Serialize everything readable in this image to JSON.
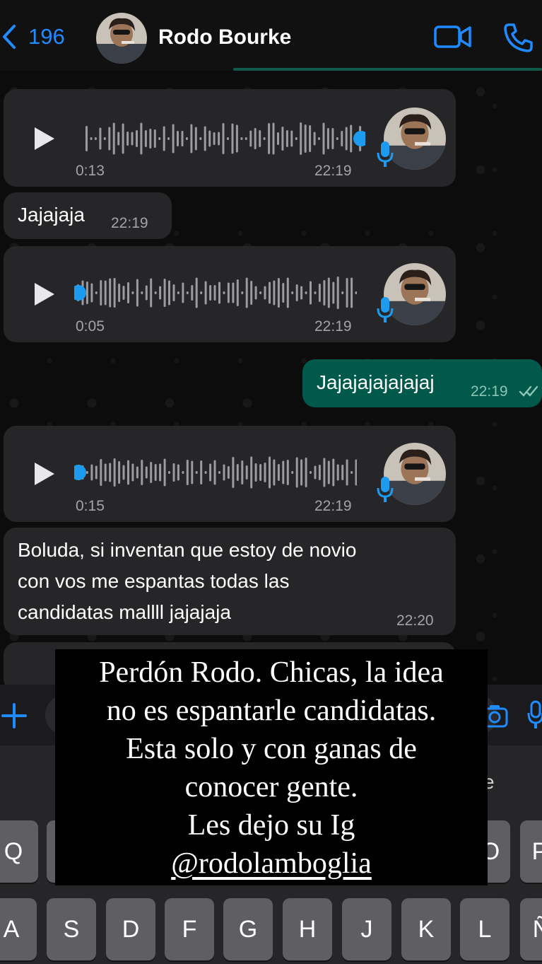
{
  "header": {
    "back_count": "196",
    "contact_name": "Rodo Bourke"
  },
  "messages": [
    {
      "type": "voice",
      "duration": "0:13",
      "time": "22:19",
      "played_fraction": 1.0
    },
    {
      "type": "text",
      "text": "Jajajaja",
      "time": "22:19"
    },
    {
      "type": "voice",
      "duration": "0:05",
      "time": "22:19",
      "played_fraction": 0.0
    },
    {
      "type": "text_out",
      "text": "Jajajajajajajaj",
      "time": "22:19",
      "status": "read"
    },
    {
      "type": "voice",
      "duration": "0:15",
      "time": "22:19",
      "played_fraction": 0.0
    },
    {
      "type": "text",
      "lines": [
        "Boluda, si inventan que estoy de novio",
        "con vos me espantas todas las",
        "candidatas mallll jajajaja"
      ],
      "time": "22:20"
    }
  ],
  "keyboard": {
    "suggestion_partial": "e",
    "row1_visible": [
      "Q",
      "O",
      "P"
    ],
    "row2": [
      "A",
      "S",
      "D",
      "F",
      "G",
      "H",
      "J",
      "K",
      "L",
      "Ñ"
    ]
  },
  "caption": {
    "lines": [
      "Perdón Rodo. Chicas, la idea",
      "no es espantarle candidatas.",
      "Esta solo y con ganas de",
      "conocer gente.",
      "Les dejo su Ig"
    ],
    "handle": "@rodolamboglia"
  },
  "colors": {
    "accent_blue": "#1f8bff",
    "bubble_in": "#262628",
    "bubble_out": "#00594a",
    "voice_dot": "#1d9bf0"
  }
}
